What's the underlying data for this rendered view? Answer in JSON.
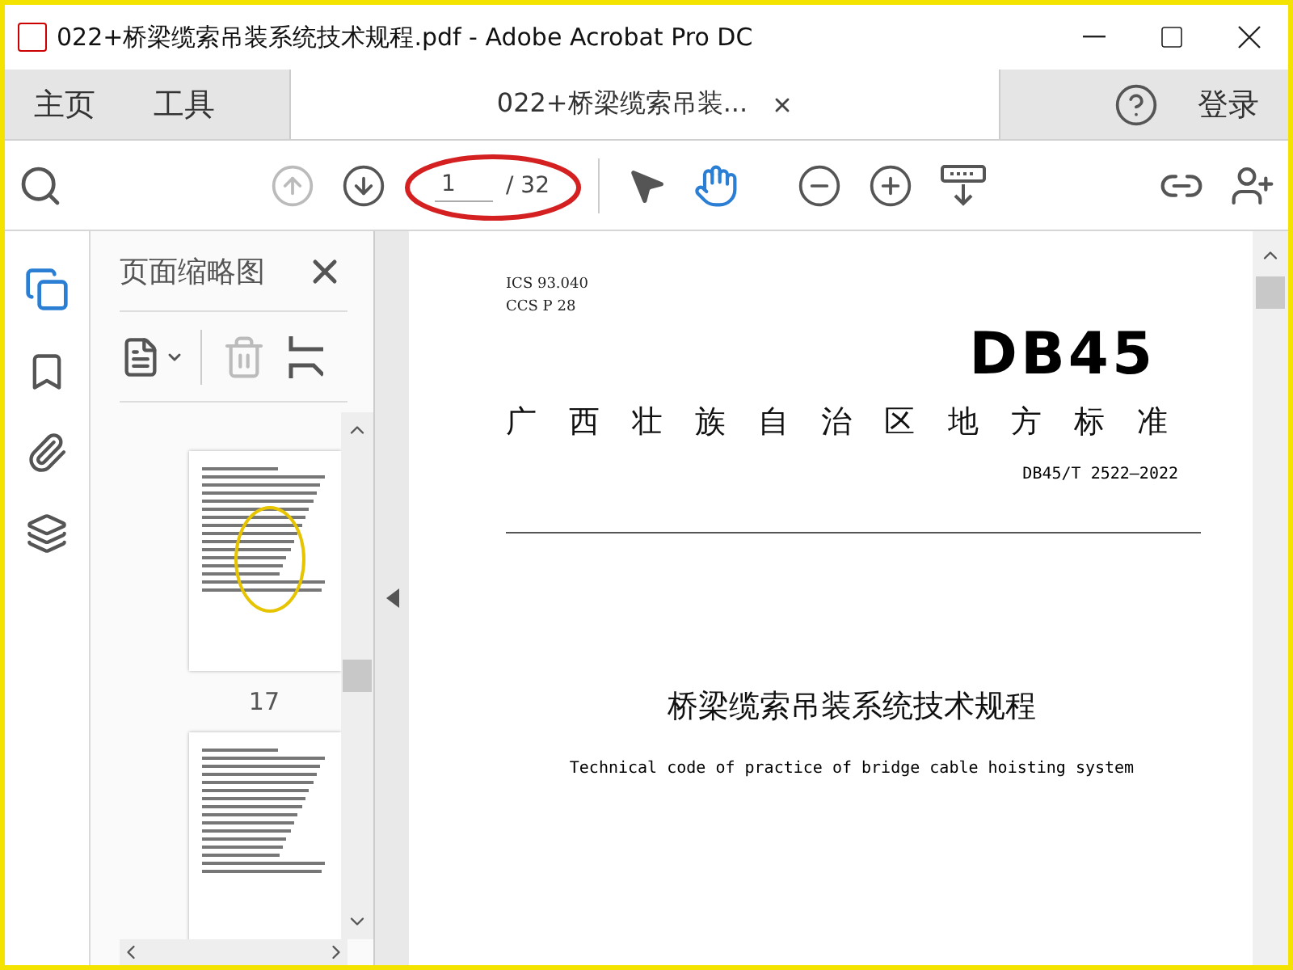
{
  "window": {
    "title": "022+桥梁缆索吊装系统技术规程.pdf - Adobe Acrobat Pro DC"
  },
  "tabs": [
    {
      "label": "主页",
      "selected": false
    },
    {
      "label": "工具",
      "selected": false
    },
    {
      "label": "022+桥梁缆索吊装...",
      "selected": true,
      "closable": true
    }
  ],
  "account": {
    "label": "登录"
  },
  "toolbar": {
    "tools": [
      {
        "kind": "prev",
        "disabled": true
      },
      {
        "kind": "next",
        "disabled": false
      }
    ],
    "page_number": "1",
    "page_total": "/ 32",
    "modes": [
      {
        "kind": "select",
        "selected": false
      },
      {
        "kind": "hand",
        "selected": true
      }
    ]
  },
  "annotation": {
    "page_circled": true
  },
  "side_panel": {
    "title": "页面缩略图",
    "thumbnails": [
      {
        "label": "17",
        "stamped": true
      },
      {
        "stamped": false
      }
    ]
  },
  "document": {
    "ics": "ICS  93.040",
    "ccs": "CCS  P 28",
    "code": "DB45",
    "issuer": "广 西 壮 族 自 治 区 地 方 标 准",
    "number": "DB45/T 2522—2022",
    "title": "桥梁缆索吊装系统技术规程",
    "subtitle": "Technical code of practice of bridge cable hoisting system"
  }
}
